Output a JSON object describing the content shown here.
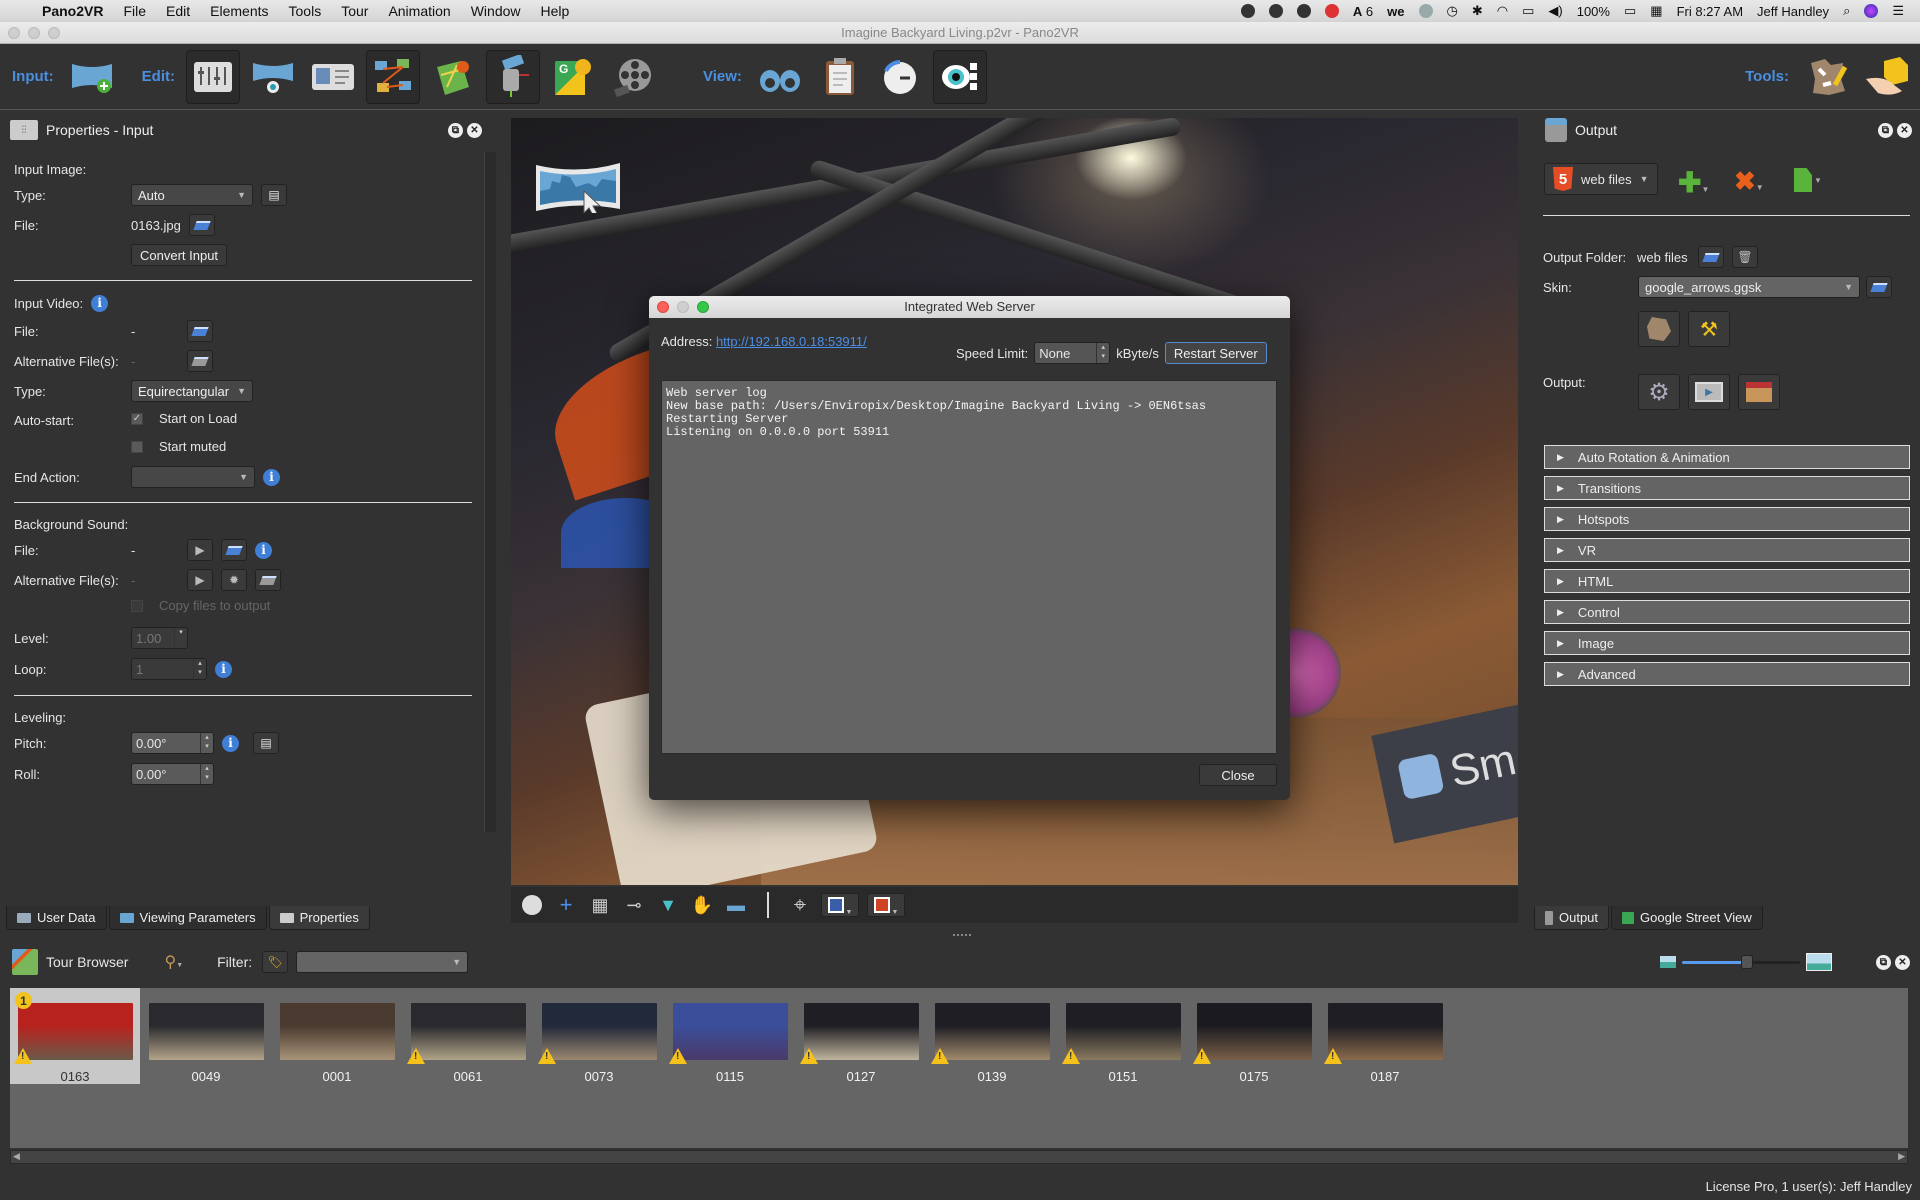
{
  "menubar": {
    "app_name": "Pano2VR",
    "items": [
      "File",
      "Edit",
      "Elements",
      "Tools",
      "Tour",
      "Animation",
      "Window",
      "Help"
    ],
    "tray_adobe_count": "6",
    "battery": "100%",
    "clock": "Fri 8:27 AM",
    "user": "Jeff Handley"
  },
  "window": {
    "title": "Imagine Backyard Living.p2vr - Pano2VR"
  },
  "toolbar": {
    "input_label": "Input:",
    "edit_label": "Edit:",
    "view_label": "View:",
    "tools_label": "Tools:"
  },
  "properties_panel": {
    "title": "Properties - Input",
    "input_image": {
      "heading": "Input Image:",
      "type_label": "Type:",
      "type_value": "Auto",
      "file_label": "File:",
      "file_value": "0163.jpg",
      "convert_button": "Convert Input"
    },
    "input_video": {
      "heading": "Input Video:",
      "file_label": "File:",
      "file_value": "-",
      "alt_label": "Alternative File(s):",
      "alt_value": "-",
      "type_label": "Type:",
      "type_value": "Equirectangular",
      "autostart_label": "Auto-start:",
      "start_on_load": "Start on Load",
      "start_on_load_checked": true,
      "start_muted": "Start muted",
      "start_muted_checked": false,
      "end_action_label": "End Action:",
      "end_action_value": ""
    },
    "background_sound": {
      "heading": "Background Sound:",
      "file_label": "File:",
      "file_value": "-",
      "alt_label": "Alternative File(s):",
      "alt_value": "-",
      "copy_files": "Copy files to output",
      "level_label": "Level:",
      "level_value": "1.00",
      "loop_label": "Loop:",
      "loop_value": "1"
    },
    "leveling": {
      "heading": "Leveling:",
      "pitch_label": "Pitch:",
      "pitch_value": "0.00°",
      "roll_label": "Roll:",
      "roll_value": "0.00°"
    },
    "tabs": [
      "User Data",
      "Viewing Parameters",
      "Properties"
    ]
  },
  "output_panel": {
    "title": "Output",
    "format": "web files",
    "output_folder_label": "Output Folder:",
    "output_folder_value": "web files",
    "skin_label": "Skin:",
    "skin_value": "google_arrows.ggsk",
    "output_label": "Output:",
    "sections": [
      "Auto Rotation & Animation",
      "Transitions",
      "Hotspots",
      "VR",
      "HTML",
      "Control",
      "Image",
      "Advanced"
    ],
    "tabs": [
      "Output",
      "Google Street View"
    ]
  },
  "dialog": {
    "title": "Integrated Web Server",
    "address_label": "Address:",
    "address_url": "http://192.168.0.18:53911/",
    "speed_limit_label": "Speed Limit:",
    "speed_limit_value": "None",
    "speed_unit": "kByte/s",
    "restart_button": "Restart Server",
    "log": "Web server log\nNew base path: /Users/Enviropix/Desktop/Imagine Backyard Living -> 0EN6tsas\nRestarting Server\nListening on 0.0.0.0 port 53911",
    "close_button": "Close"
  },
  "tour_browser": {
    "title": "Tour Browser",
    "filter_label": "Filter:",
    "filter_value": "",
    "thumbnail_size_fraction": 0.55,
    "thumbnails": [
      {
        "label": "0163",
        "selected": true,
        "warning": true,
        "start_badge": "1",
        "colors": [
          "#b8221e",
          "#6a5a4a"
        ]
      },
      {
        "label": "0049",
        "selected": false,
        "warning": false,
        "colors": [
          "#2a2a2e",
          "#b4a48a"
        ]
      },
      {
        "label": "0001",
        "selected": false,
        "warning": false,
        "colors": [
          "#4a3a30",
          "#a89478"
        ]
      },
      {
        "label": "0061",
        "selected": false,
        "warning": true,
        "colors": [
          "#2a2a2e",
          "#b0a488"
        ]
      },
      {
        "label": "0073",
        "selected": false,
        "warning": true,
        "colors": [
          "#22293a",
          "#9a8870"
        ]
      },
      {
        "label": "0115",
        "selected": false,
        "warning": true,
        "colors": [
          "#3a4e9a",
          "#4a3a6a"
        ]
      },
      {
        "label": "0127",
        "selected": false,
        "warning": true,
        "colors": [
          "#1e1e24",
          "#c0b49e"
        ]
      },
      {
        "label": "0139",
        "selected": false,
        "warning": true,
        "colors": [
          "#1e1e24",
          "#a08a6c"
        ]
      },
      {
        "label": "0151",
        "selected": false,
        "warning": true,
        "colors": [
          "#1e1e24",
          "#8a7a60"
        ]
      },
      {
        "label": "0175",
        "selected": false,
        "warning": true,
        "colors": [
          "#1a1a20",
          "#7a6048"
        ]
      },
      {
        "label": "0187",
        "selected": false,
        "warning": true,
        "colors": [
          "#1e1e24",
          "#8a6a4c"
        ]
      }
    ]
  },
  "status_bar": {
    "license": "License Pro, 1 user(s): Jeff Handley"
  },
  "viewer": {
    "sign_text": "Sm"
  }
}
